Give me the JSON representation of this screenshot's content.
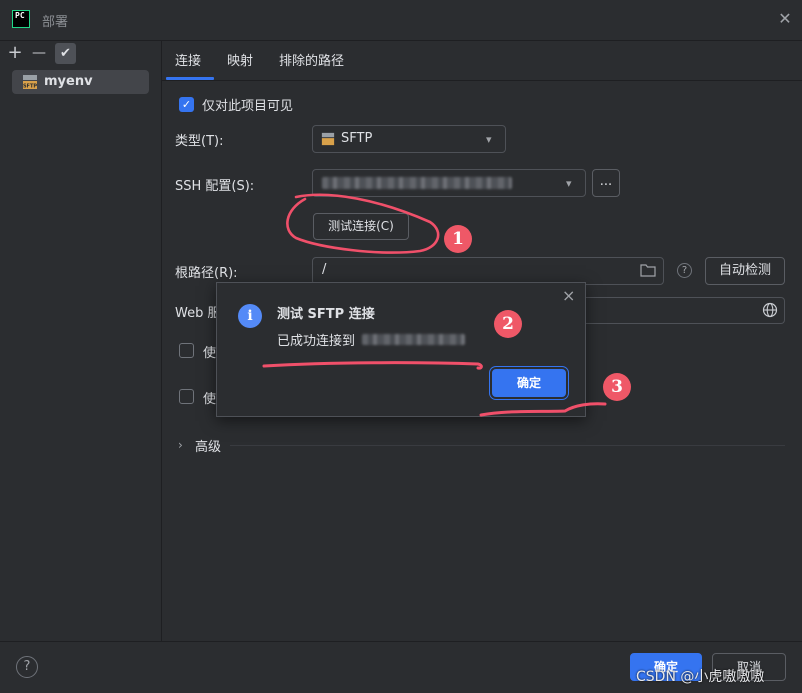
{
  "window": {
    "title": "部署",
    "logo_text": "PC"
  },
  "sidebar": {
    "toolbar": {
      "add": "+",
      "remove": "—",
      "check": "✔"
    },
    "servers": [
      {
        "name": "myenv",
        "icon_text": "SFTP"
      }
    ]
  },
  "tabs": [
    {
      "label": "连接",
      "active": true
    },
    {
      "label": "映射",
      "active": false
    },
    {
      "label": "排除的路径",
      "active": false
    }
  ],
  "connection": {
    "visible_only_label": "仅对此项目可见",
    "type_label": "类型(T):",
    "type_value": "SFTP",
    "ssh_label": "SSH 配置(S):",
    "more_button": "...",
    "test_button": "测试连接(C)",
    "root_label": "根路径(R):",
    "root_value": "/",
    "autodetect_button": "自动检测",
    "web_label": "Web 服",
    "use_label_1": "使",
    "use_label_2": "使",
    "advanced_label": "高级"
  },
  "popup": {
    "title": "测试 SFTP 连接",
    "message": "已成功连接到",
    "ok_button": "确定",
    "info_glyph": "i",
    "close_glyph": "×"
  },
  "annotations": [
    "1",
    "2",
    "3"
  ],
  "footer": {
    "ok": "确定",
    "cancel": "取消",
    "help": "?",
    "watermark": "CSDN @小虎嗷嗷嗷"
  },
  "colors": {
    "accent": "#3574f0",
    "annotation": "#ef5867",
    "background": "#2b2d30"
  }
}
